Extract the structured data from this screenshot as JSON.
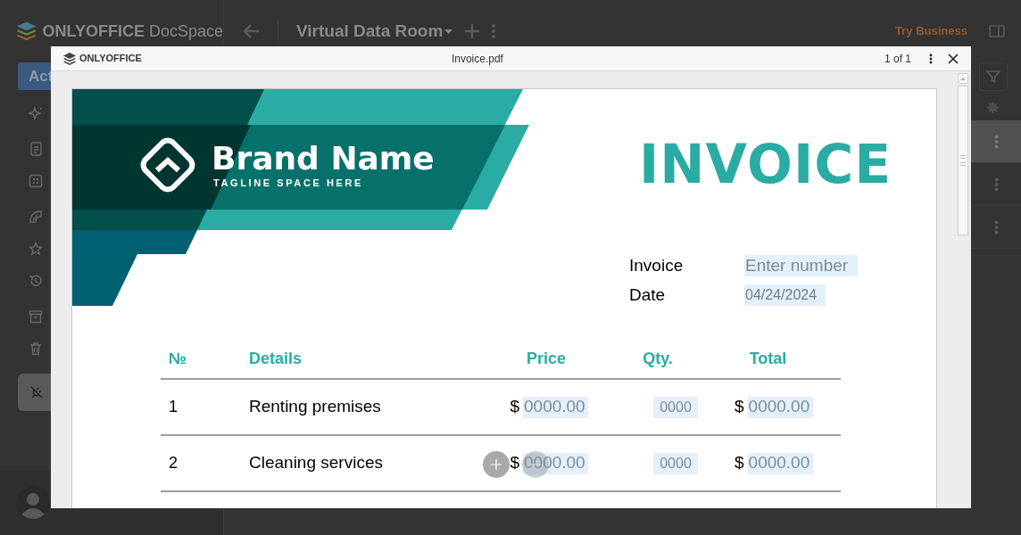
{
  "app": {
    "logo": "**ONLYOFFICE** DocSpace",
    "title": "Virtual Data Room",
    "upgrade_link": "Try Business",
    "action_button": "Act"
  },
  "sidebar": {
    "sections": [
      {
        "items": [
          {
            "selected": false
          }
        ]
      },
      {
        "items": [
          {
            "selected": false
          },
          {
            "selected": false
          }
        ]
      },
      {
        "items": [
          {
            "selected": false
          },
          {
            "selected": false
          },
          {
            "selected": false
          }
        ]
      },
      {
        "items": [
          {
            "selected": false
          },
          {
            "selected": false
          }
        ]
      },
      {
        "items": [
          {
            "selected": true
          }
        ]
      }
    ]
  },
  "files": [
    {
      "selected": true
    },
    {
      "selected": false
    },
    {
      "selected": false
    }
  ],
  "viewer": {
    "brand": "ONLYOFFICE",
    "file_name": "Invoice.pdf",
    "page_counter": "1 of 1"
  },
  "document": {
    "brand_name": "Brand Name",
    "tagline": "TAGLINE SPACE HERE",
    "heading": "INVOICE",
    "fields": [
      {
        "label": "Invoice",
        "placeholder": "Enter number"
      },
      {
        "label": "Date",
        "value": "04/24/2024"
      }
    ],
    "table": {
      "columns": [
        "№",
        "Details",
        "Price",
        "Qty.",
        "Total"
      ],
      "rows": [
        {
          "number": "1",
          "details": "Renting premises",
          "price": {
            "currency": "$",
            "placeholder": "0000.00"
          },
          "qty": {
            "placeholder": "0000"
          },
          "total": {
            "currency": "$",
            "placeholder": "0000.00"
          }
        },
        {
          "number": "2",
          "details": "Cleaning services",
          "price": {
            "currency": "$",
            "placeholder": "0000.00"
          },
          "qty": {
            "placeholder": "0000"
          },
          "total": {
            "currency": "$",
            "placeholder": "0000.00"
          }
        }
      ]
    }
  }
}
